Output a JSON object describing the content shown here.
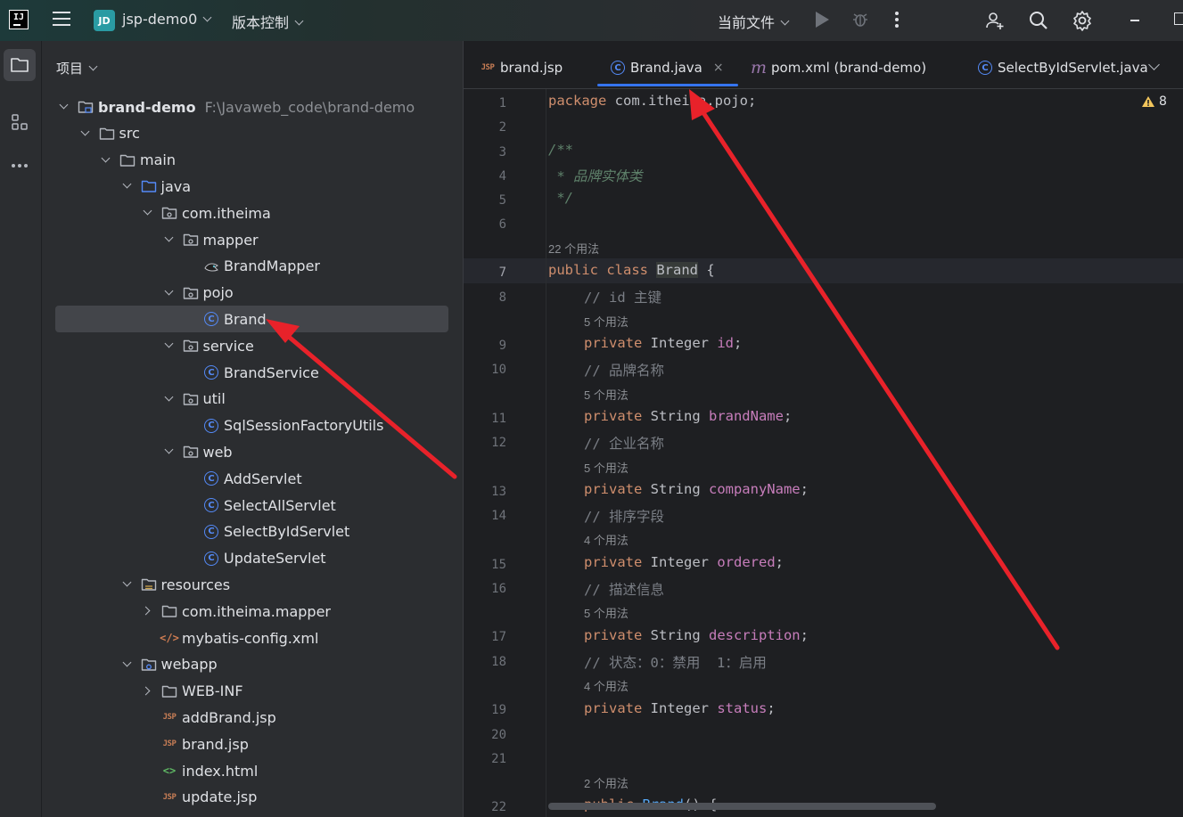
{
  "titlebar": {
    "logo": "IJ",
    "project_badge": "JD",
    "project_name": "jsp-demo0",
    "vcs_label": "版本控制",
    "run_config": "当前文件"
  },
  "toolstrip": {
    "icons": [
      "folder-icon",
      "structure-icon",
      "more-icon"
    ]
  },
  "project_panel": {
    "title": "项目",
    "tree": [
      {
        "label": "brand-demo",
        "hint": "F:\\Javaweb_code\\brand-demo",
        "icon": "module-folder-icon"
      },
      {
        "label": "src",
        "icon": "folder-icon"
      },
      {
        "label": "main",
        "icon": "folder-icon"
      },
      {
        "label": "java",
        "icon": "source-folder-icon"
      },
      {
        "label": "com.itheima",
        "icon": "package-icon"
      },
      {
        "label": "mapper",
        "icon": "package-icon"
      },
      {
        "label": "BrandMapper",
        "icon": "mybatis-mapper-icon"
      },
      {
        "label": "pojo",
        "icon": "package-icon"
      },
      {
        "label": "Brand",
        "icon": "class-icon"
      },
      {
        "label": "service",
        "icon": "package-icon"
      },
      {
        "label": "BrandService",
        "icon": "class-icon"
      },
      {
        "label": "util",
        "icon": "package-icon"
      },
      {
        "label": "SqlSessionFactoryUtils",
        "icon": "class-icon"
      },
      {
        "label": "web",
        "icon": "package-icon"
      },
      {
        "label": "AddServlet",
        "icon": "class-icon"
      },
      {
        "label": "SelectAllServlet",
        "icon": "class-icon"
      },
      {
        "label": "SelectByIdServlet",
        "icon": "class-icon"
      },
      {
        "label": "UpdateServlet",
        "icon": "class-icon"
      },
      {
        "label": "resources",
        "icon": "resources-folder-icon"
      },
      {
        "label": "com.itheima.mapper",
        "icon": "folder-icon"
      },
      {
        "label": "mybatis-config.xml",
        "icon": "xml-icon"
      },
      {
        "label": "webapp",
        "icon": "web-folder-icon"
      },
      {
        "label": "WEB-INF",
        "icon": "folder-icon"
      },
      {
        "label": "addBrand.jsp",
        "icon": "jsp-icon"
      },
      {
        "label": "brand.jsp",
        "icon": "jsp-icon"
      },
      {
        "label": "index.html",
        "icon": "html-icon"
      },
      {
        "label": "update.jsp",
        "icon": "jsp-icon"
      }
    ]
  },
  "editor": {
    "tabs": [
      {
        "label": "brand.jsp",
        "icon": "jsp-icon",
        "active": false
      },
      {
        "label": "Brand.java",
        "icon": "class-icon",
        "active": true,
        "close": "×"
      },
      {
        "label": "pom.xml (brand-demo)",
        "icon": "maven-icon",
        "active": false
      },
      {
        "label": "SelectByIdServlet.java",
        "icon": "class-icon",
        "active": false
      }
    ],
    "warning_count": "8",
    "line_numbers": [
      "1",
      "2",
      "3",
      "4",
      "5",
      "6",
      "7",
      "8",
      "9",
      "10",
      "11",
      "12",
      "13",
      "14",
      "15",
      "16",
      "17",
      "18",
      "19",
      "20",
      "21",
      "22"
    ],
    "usage_hints": {
      "class": "22 个用法",
      "id": "5 个用法",
      "brandName": "5 个用法",
      "companyName": "5 个用法",
      "ordered": "4 个用法",
      "description": "5 个用法",
      "status": "4 个用法",
      "ctor": "2 个用法"
    },
    "code": {
      "l1_kw": "package",
      "l1_rest": " com.itheima.pojo;",
      "l3": "/**",
      "l4": " * 品牌实体类",
      "l5": " */",
      "l7_kw": "public class",
      "l7_name": "Brand",
      "l7_rest": " {",
      "l8": "// id 主键",
      "l9_kw": "private",
      "l9_type": " Integer ",
      "l9_fld": "id",
      "l10": "// 品牌名称",
      "l11_kw": "private",
      "l11_type": " String ",
      "l11_fld": "brandName",
      "l12": "// 企业名称",
      "l13_kw": "private",
      "l13_type": " String ",
      "l13_fld": "companyName",
      "l14": "// 排序字段",
      "l15_kw": "private",
      "l15_type": " Integer ",
      "l15_fld": "ordered",
      "l16": "// 描述信息",
      "l17_kw": "private",
      "l17_type": " String ",
      "l17_fld": "description",
      "l18": "// 状态：0：禁用  1：启用",
      "l19_kw": "private",
      "l19_type": " Integer ",
      "l19_fld": "status",
      "l22_kw": "public",
      "l22_fn": "Brand",
      "l22_rest": "() {",
      "semicolon": ";"
    }
  },
  "colors": {
    "accent": "#3574f0",
    "arrow": "#e8222a",
    "keyword": "#cf8e6d",
    "field": "#c77dbb"
  }
}
